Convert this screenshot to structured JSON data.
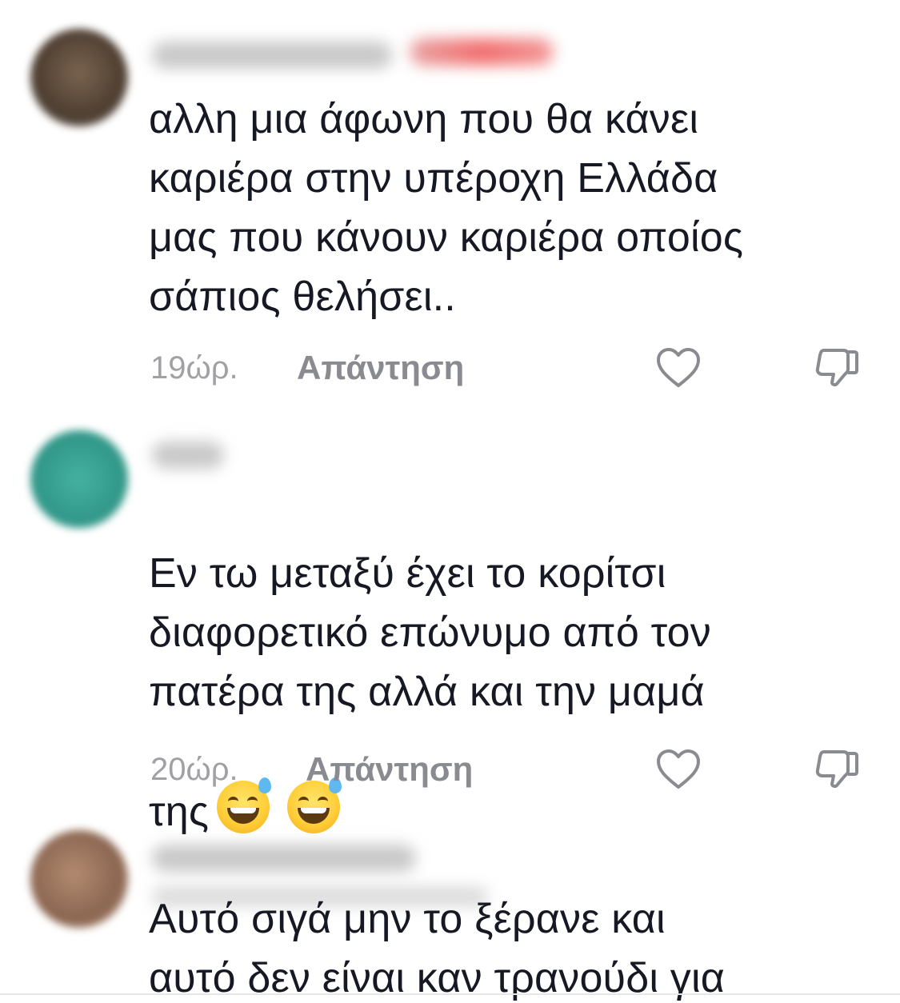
{
  "comments": [
    {
      "text": "αλλη μια άφωνη που θα κάνει\nκαριέρα στην υπέροχη Ελλάδα\nμας που κάνουν καριέρα οποίος\nσάπιος θελήσει..",
      "time": "19ώρ.",
      "reply_label": "Απάντηση",
      "avatar_color": "#6b5a4a"
    },
    {
      "text": "Εν τω μεταξύ έχει το κορίτσι\nδιαφορετικό επώνυμο από τον\nπατέρα της αλλά και την μαμά",
      "text_last_line": "της",
      "emojis": [
        "😅",
        "😅"
      ],
      "time": "20ώρ.",
      "reply_label": "Απάντηση",
      "avatar_color": "#3aa394"
    },
    {
      "text": "Αυτό σιγά μην το ξέρανε και\nαυτό δεν είναι καν τρανούδι για",
      "avatar_color": "#9a7560"
    }
  ],
  "icons": {
    "like": "heart-outline-icon",
    "dislike": "thumbs-down-outline-icon"
  },
  "colors": {
    "text": "#161823",
    "meta": "#a0a0a5",
    "reply": "#8a8b91"
  }
}
